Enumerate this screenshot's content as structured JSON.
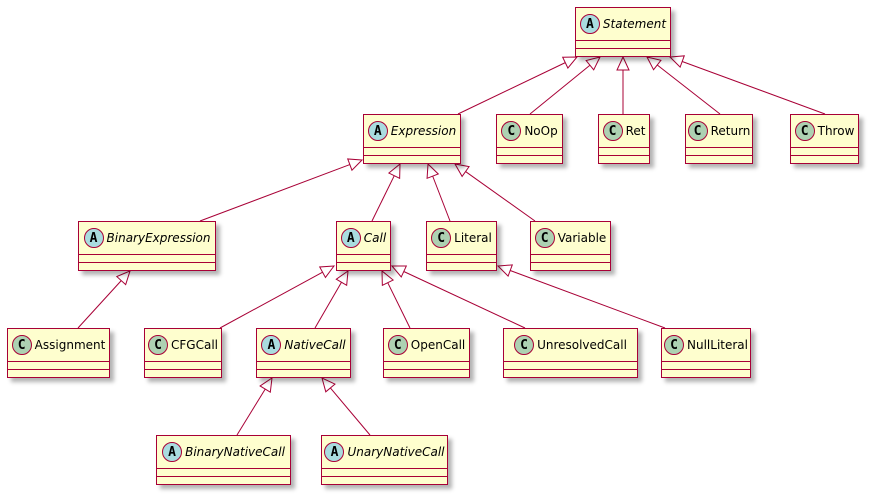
{
  "colors": {
    "box_fill": "#FEFECE",
    "border": "#A80036",
    "class_badge": "#ADD1B2",
    "abstract_badge": "#A9DCDF"
  },
  "classes": [
    {
      "id": "Statement",
      "name": "Statement",
      "kind": "abstract",
      "badge": "A"
    },
    {
      "id": "Expression",
      "name": "Expression",
      "kind": "abstract",
      "badge": "A"
    },
    {
      "id": "NoOp",
      "name": "NoOp",
      "kind": "class",
      "badge": "C"
    },
    {
      "id": "Ret",
      "name": "Ret",
      "kind": "class",
      "badge": "C"
    },
    {
      "id": "Return",
      "name": "Return",
      "kind": "class",
      "badge": "C"
    },
    {
      "id": "Throw",
      "name": "Throw",
      "kind": "class",
      "badge": "C"
    },
    {
      "id": "BinaryExpression",
      "name": "BinaryExpression",
      "kind": "abstract",
      "badge": "A"
    },
    {
      "id": "Call",
      "name": "Call",
      "kind": "abstract",
      "badge": "A"
    },
    {
      "id": "Literal",
      "name": "Literal",
      "kind": "class",
      "badge": "C"
    },
    {
      "id": "Variable",
      "name": "Variable",
      "kind": "class",
      "badge": "C"
    },
    {
      "id": "Assignment",
      "name": "Assignment",
      "kind": "class",
      "badge": "C"
    },
    {
      "id": "CFGCall",
      "name": "CFGCall",
      "kind": "class",
      "badge": "C"
    },
    {
      "id": "NativeCall",
      "name": "NativeCall",
      "kind": "abstract",
      "badge": "A"
    },
    {
      "id": "OpenCall",
      "name": "OpenCall",
      "kind": "class",
      "badge": "C"
    },
    {
      "id": "UnresolvedCall",
      "name": "UnresolvedCall",
      "kind": "class",
      "badge": "C"
    },
    {
      "id": "NullLiteral",
      "name": "NullLiteral",
      "kind": "class",
      "badge": "C"
    },
    {
      "id": "BinaryNativeCall",
      "name": "BinaryNativeCall",
      "kind": "abstract",
      "badge": "A"
    },
    {
      "id": "UnaryNativeCall",
      "name": "UnaryNativeCall",
      "kind": "abstract",
      "badge": "A"
    }
  ],
  "inheritance": [
    {
      "child": "Expression",
      "parent": "Statement"
    },
    {
      "child": "NoOp",
      "parent": "Statement"
    },
    {
      "child": "Ret",
      "parent": "Statement"
    },
    {
      "child": "Return",
      "parent": "Statement"
    },
    {
      "child": "Throw",
      "parent": "Statement"
    },
    {
      "child": "BinaryExpression",
      "parent": "Expression"
    },
    {
      "child": "Call",
      "parent": "Expression"
    },
    {
      "child": "Literal",
      "parent": "Expression"
    },
    {
      "child": "Variable",
      "parent": "Expression"
    },
    {
      "child": "Assignment",
      "parent": "BinaryExpression"
    },
    {
      "child": "CFGCall",
      "parent": "Call"
    },
    {
      "child": "NativeCall",
      "parent": "Call"
    },
    {
      "child": "OpenCall",
      "parent": "Call"
    },
    {
      "child": "UnresolvedCall",
      "parent": "Call"
    },
    {
      "child": "NullLiteral",
      "parent": "Literal"
    },
    {
      "child": "BinaryNativeCall",
      "parent": "NativeCall"
    },
    {
      "child": "UnaryNativeCall",
      "parent": "NativeCall"
    }
  ]
}
